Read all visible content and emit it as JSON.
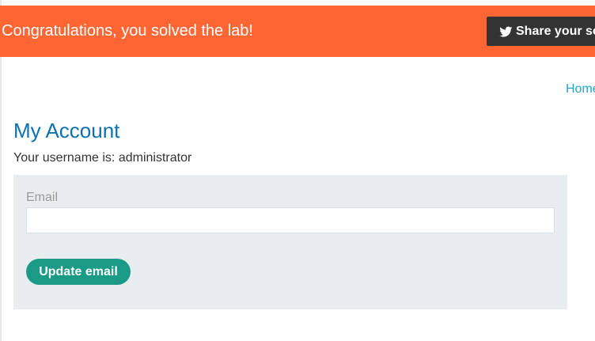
{
  "banner": {
    "message": "Congratulations, you solved the lab!",
    "share_label": "Share your solution!",
    "share_icon": "twitter-bird-icon",
    "background_color": "#ff6633"
  },
  "nav": {
    "home_label": "Home"
  },
  "account": {
    "title": "My Account",
    "username_line": "Your username is: administrator"
  },
  "form": {
    "email_label": "Email",
    "email_value": "",
    "email_placeholder": "",
    "submit_label": "Update email",
    "button_color": "#1b9a85"
  }
}
